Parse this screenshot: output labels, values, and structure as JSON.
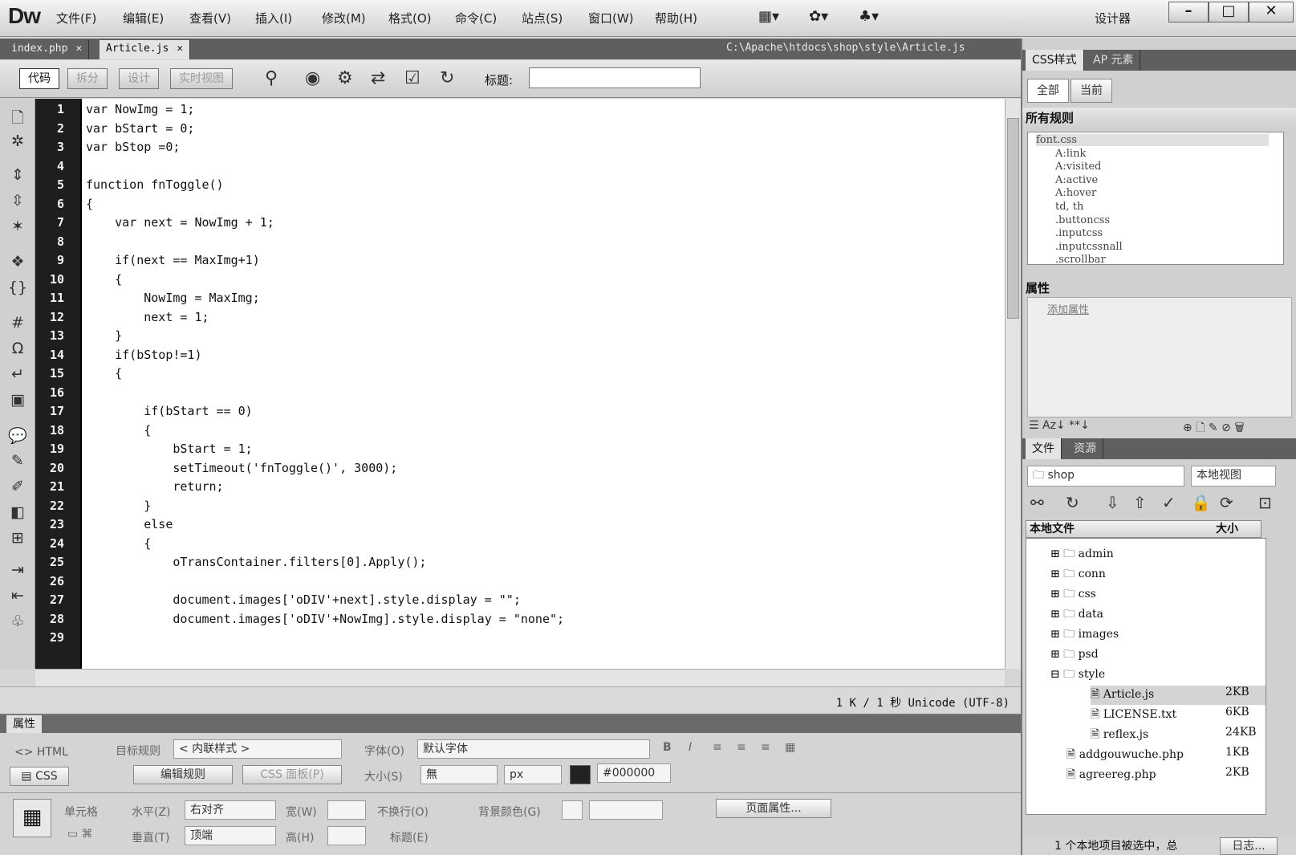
{
  "app": {
    "logo": "Dw",
    "designer": "设计器"
  },
  "menu": [
    "文件(F)",
    "编辑(E)",
    "查看(V)",
    "插入(I)",
    "修改(M)",
    "格式(O)",
    "命令(C)",
    "站点(S)",
    "窗口(W)",
    "帮助(H)"
  ],
  "tabs": [
    {
      "label": "index.php"
    },
    {
      "label": "Article.js"
    }
  ],
  "filepath": "C:\\Apache\\htdocs\\shop\\style\\Article.js",
  "doctoolbar": {
    "views": [
      "代码",
      "拆分",
      "设计",
      "实时视图"
    ],
    "title_label": "标题:",
    "title_value": ""
  },
  "code": {
    "lines": [
      "var NowImg = 1;",
      "var bStart = 0;",
      "var bStop =0;",
      "",
      "function fnToggle()",
      "{",
      "    var next = NowImg + 1;",
      "",
      "    if(next == MaxImg+1)",
      "    {",
      "        NowImg = MaxImg;",
      "        next = 1;",
      "    }",
      "    if(bStop!=1)",
      "    {",
      "",
      "        if(bStart == 0)",
      "        {",
      "            bStart = 1;",
      "            setTimeout('fnToggle()', 3000);",
      "            return;",
      "        }",
      "        else",
      "        {",
      "            oTransContainer.filters[0].Apply();",
      "",
      "            document.images['oDIV'+next].style.display = \"\";",
      "            document.images['oDIV'+NowImg].style.display = \"none\";",
      ""
    ],
    "numbers": [
      "1",
      "2",
      "3",
      "4",
      "5",
      "6",
      "7",
      "8",
      "9",
      "10",
      "11",
      "12",
      "13",
      "14",
      "15",
      "16",
      "17",
      "18",
      "19",
      "20",
      "21",
      "22",
      "23",
      "24",
      "25",
      "26",
      "27",
      "28",
      "29"
    ]
  },
  "status": "1 K / 1 秒 Unicode (UTF-8)",
  "properties": {
    "title": "属性",
    "html": "HTML",
    "css": "CSS",
    "target_rule_label": "目标规则",
    "target_rule": "< 内联样式 >",
    "edit_rule": "编辑规则",
    "css_panel": "CSS 面板(P)",
    "font_label": "字体(O)",
    "font_value": "默认字体",
    "size_label": "大小(S)",
    "size_value": "無",
    "unit": "px",
    "color_value": "#000000",
    "cell": "单元格",
    "horz_label": "水平(Z)",
    "horz_value": "右对齐",
    "width_label": "宽(W)",
    "nowrap_label": "不换行(O)",
    "bg_label": "背景颜色(G)",
    "vert_label": "垂直(T)",
    "vert_value": "顶端",
    "height_label": "高(H)",
    "header_label": "标题(E)",
    "page_props": "页面属性..."
  },
  "css_panel": {
    "tabs": [
      "CSS样式",
      "AP 元素"
    ],
    "modes": [
      "全部",
      "当前"
    ],
    "all_rules": "所有规则",
    "rules": [
      "font.css",
      "A:link",
      "A:visited",
      "A:active",
      "A:hover",
      "td, th",
      ".buttoncss",
      ".inputcss",
      ".inputcssnall",
      ".scrollbar"
    ],
    "attr_label": "属性",
    "add_attr": "添加属性"
  },
  "files_panel": {
    "tabs": [
      "文件",
      "资源"
    ],
    "site": "shop",
    "view": "本地视图",
    "col_local": "本地文件",
    "col_size": "大小",
    "items": [
      {
        "name": "admin",
        "size": ""
      },
      {
        "name": "conn",
        "size": ""
      },
      {
        "name": "css",
        "size": ""
      },
      {
        "name": "data",
        "size": ""
      },
      {
        "name": "images",
        "size": ""
      },
      {
        "name": "psd",
        "size": ""
      },
      {
        "name": "style",
        "size": ""
      },
      {
        "name": "Article.js",
        "size": "2KB"
      },
      {
        "name": "LICENSE.txt",
        "size": "6KB"
      },
      {
        "name": "reflex.js",
        "size": "24KB"
      },
      {
        "name": "addgouwuche.php",
        "size": "1KB"
      },
      {
        "name": "agreereg.php",
        "size": "2KB"
      }
    ],
    "status": "1 个本地项目被选中，总",
    "log": "日志..."
  }
}
